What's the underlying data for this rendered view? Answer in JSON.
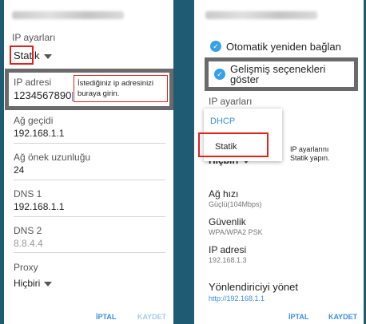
{
  "left": {
    "ip_settings_label": "IP ayarları",
    "ip_settings_value": "Statik",
    "ip_address_label": "IP adresi",
    "ip_address_value": "1234567890",
    "ip_hint_line1": "İstediğiniz ip adresinizi",
    "ip_hint_line2": "buraya girin.",
    "gateway_label": "Ağ geçidi",
    "gateway_value": "192.168.1.1",
    "prefix_label": "Ağ önek uzunluğu",
    "prefix_value": "24",
    "dns1_label": "DNS 1",
    "dns1_value": "192.168.1.1",
    "dns2_label": "DNS 2",
    "dns2_placeholder": "8.8.4.4",
    "proxy_label": "Proxy",
    "proxy_value": "Hiçbiri",
    "cancel_label": "İPTAL",
    "save_label": "KAYDET"
  },
  "right": {
    "auto_reconnect_label": "Otomatik yeniden bağlan",
    "advanced_label_line1": "Gelişmiş seçenekleri",
    "advanced_label_line2": "göster",
    "ip_settings_label": "IP ayarları",
    "option_dhcp": "DHCP",
    "option_static": "Statik",
    "proxy_value_partial": "Hiçbiri",
    "note_line1": "IP ayarlarını",
    "note_line2": "Statik yapın.",
    "speed_label": "Ağ hızı",
    "speed_value": "Güçlü(104Mbps)",
    "security_label": "Güvenlik",
    "security_value": "WPA/WPA2 PSK",
    "ip_address_label": "IP adresi",
    "ip_address_value": "192.168.1.3",
    "manage_router_label": "Yönlendiriciyi yönet",
    "manage_router_link": "http://192.168.1.1",
    "cancel_label": "İPTAL",
    "save_label": "KAYDET"
  },
  "colors": {
    "accent": "#3a8fdc",
    "highlight_red": "#e0221f",
    "highlight_grey": "#6a6a6a",
    "background": "#1f5c73"
  }
}
